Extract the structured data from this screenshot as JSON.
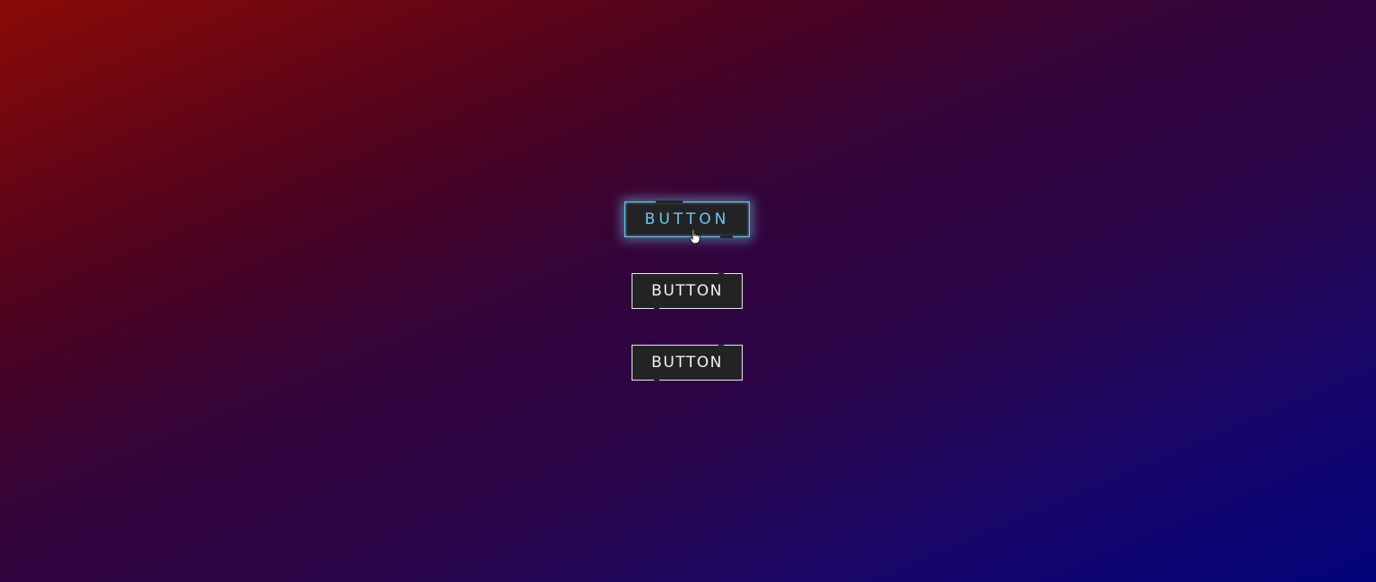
{
  "buttons": [
    {
      "label": "BUTTON",
      "state": "hover"
    },
    {
      "label": "BUTTON",
      "state": "normal"
    },
    {
      "label": "BUTTON",
      "state": "normal"
    }
  ],
  "colors": {
    "background_top_left": "#8a0a06",
    "background_bottom_right": "#02037a",
    "button_fill": "#232325",
    "button_border": "#e8e8e8",
    "hover_accent": "#6fc6ec"
  },
  "cursor": {
    "icon": "hand-pointer-icon"
  }
}
